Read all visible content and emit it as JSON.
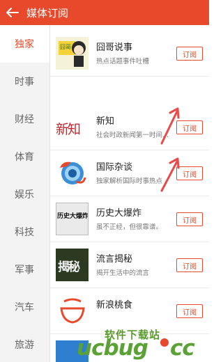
{
  "header": {
    "title": "媒体订阅"
  },
  "sidebar": {
    "items": [
      {
        "label": "独家"
      },
      {
        "label": "时事"
      },
      {
        "label": "财经"
      },
      {
        "label": "体育"
      },
      {
        "label": "娱乐"
      },
      {
        "label": "科技"
      },
      {
        "label": "军事"
      },
      {
        "label": "汽车"
      },
      {
        "label": "旅游"
      }
    ]
  },
  "feeds": [
    {
      "name": "囧哥说事",
      "desc": "热点话题事件吐槽",
      "button": "订阅"
    },
    {
      "name": "新知",
      "desc": "社会时政新闻第一时间...",
      "button": "订阅"
    },
    {
      "name": "国际杂谈",
      "desc": "独家解析国际时事热点",
      "button": "订阅"
    },
    {
      "name": "历史大爆炸",
      "desc": "虽不正经，但很靠谱。",
      "button": "订阅"
    },
    {
      "name": "流言揭秘",
      "desc": "揭开生活中的流言",
      "button": "订阅"
    },
    {
      "name": "新浪桃食",
      "desc": "",
      "button": "订阅"
    }
  ],
  "thumbs": {
    "jiong_text": "囧哥",
    "xinzhi_text": "新知",
    "lishi_text": "历史大爆炸",
    "liuyan_text": "揭秘"
  },
  "watermark": {
    "brand": "ucbug",
    "tld": "cc",
    "cn": "软件下载站",
    "url": "ucbug.com"
  },
  "colors": {
    "accent": "#e8492a",
    "watermark": "#5aa236"
  }
}
